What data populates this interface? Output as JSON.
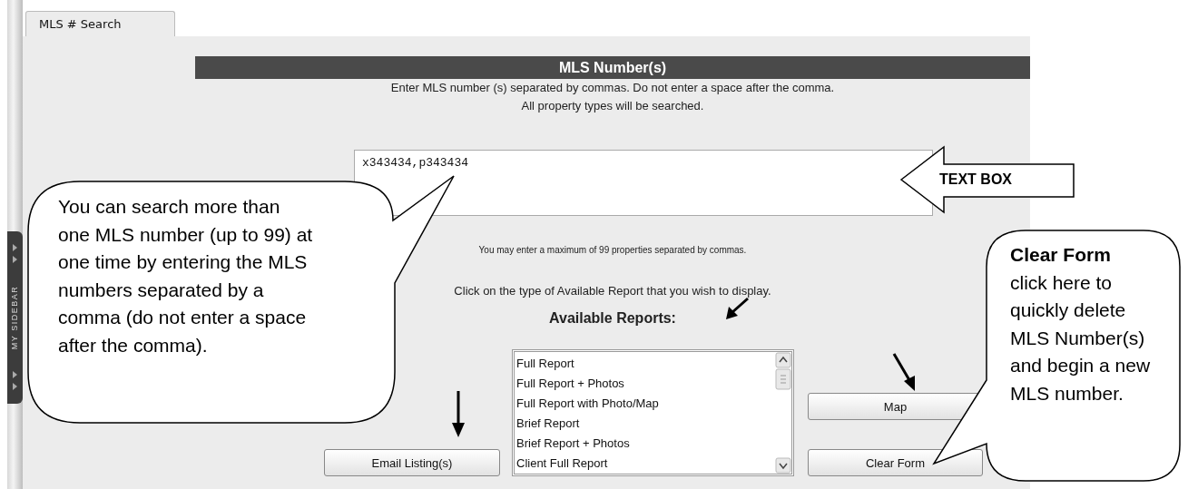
{
  "sidebar_tab": "MY SIDEBAR",
  "tabs": [
    {
      "label": "MLS # Search",
      "selected": true
    }
  ],
  "header": "MLS Number(s)",
  "instructions": [
    "Enter MLS number (s) separated by commas. Do not enter a space after the comma.",
    "All property types will be searched."
  ],
  "mls_field": {
    "value": "x343434,p343434"
  },
  "max_note": "You may enter a maximum of 99 properties separated by commas.",
  "report_prompt": "Click on the type of Available Report that you wish to display.",
  "reports": {
    "title": "Available Reports:",
    "items": [
      {
        "label": "Full Report",
        "selected": false
      },
      {
        "label": "Full Report + Photos",
        "selected": false
      },
      {
        "label": "Full Report with Photo/Map",
        "selected": false
      },
      {
        "label": "Brief Report",
        "selected": false
      },
      {
        "label": "Brief Report + Photos",
        "selected": false
      },
      {
        "label": "Client Full Report",
        "selected": false
      }
    ]
  },
  "buttons": [
    {
      "label": "Email Listing(s)",
      "kind": "email"
    },
    {
      "label": "Map",
      "kind": "map"
    },
    {
      "label": "Clear Form",
      "kind": "clear"
    }
  ],
  "annotations": [
    {
      "kind": "callout_left",
      "text": "You can search more than one MLS number (up to 99) at one time by entering the MLS numbers separated by a comma (do not enter a space after the comma)."
    },
    {
      "kind": "callout_right",
      "title": "Clear Form",
      "text": "click here to quickly delete MLS Number(s) and begin a new MLS number."
    },
    {
      "kind": "arrow_label",
      "text": "TEXT BOX"
    }
  ]
}
